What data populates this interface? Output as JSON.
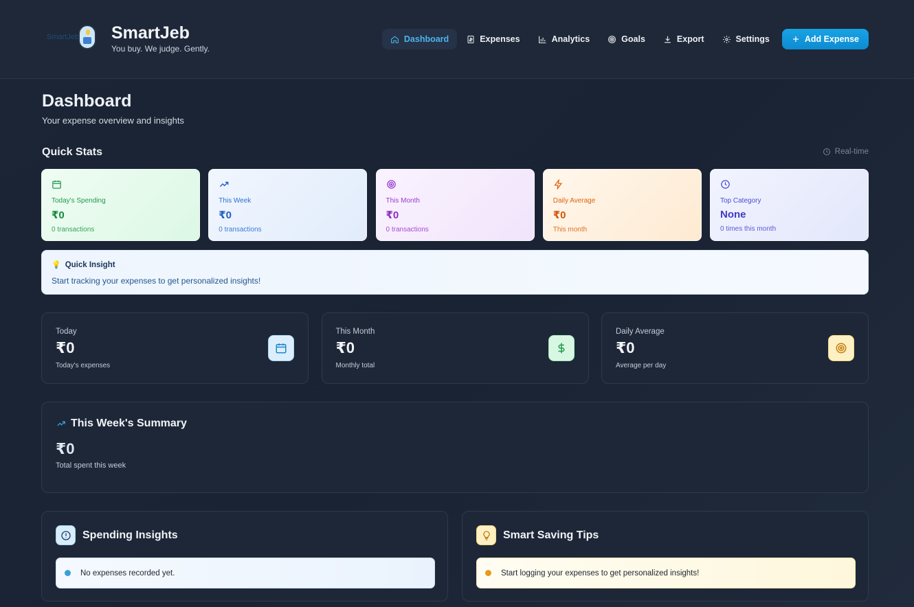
{
  "app": {
    "title": "SmartJeb",
    "tagline": "You buy. We judge. Gently.",
    "logo_alt": "SmartJeb"
  },
  "nav": {
    "items": [
      {
        "label": "Dashboard",
        "icon": "home-icon",
        "active": true
      },
      {
        "label": "Expenses",
        "icon": "receipt-icon"
      },
      {
        "label": "Analytics",
        "icon": "bar-chart-icon"
      },
      {
        "label": "Goals",
        "icon": "target-icon"
      },
      {
        "label": "Export",
        "icon": "download-icon"
      },
      {
        "label": "Settings",
        "icon": "gear-icon"
      }
    ],
    "add_button": "Add Expense"
  },
  "page": {
    "title": "Dashboard",
    "subtitle": "Your expense overview and insights"
  },
  "quick_stats": {
    "title": "Quick Stats",
    "realtime": "Real-time",
    "cards": [
      {
        "label": "Today's Spending",
        "value": "₹0",
        "sub": "0 transactions",
        "icon": "calendar-icon",
        "color": "#1f9a4a"
      },
      {
        "label": "This Week",
        "value": "₹0",
        "sub": "0 transactions",
        "icon": "trending-up-icon",
        "color": "#2b6fd1"
      },
      {
        "label": "This Month",
        "value": "₹0",
        "sub": "0 transactions",
        "icon": "target-icon",
        "color": "#9b3ad1"
      },
      {
        "label": "Daily Average",
        "value": "₹0",
        "sub": "This month",
        "icon": "lightning-icon",
        "color": "#e0620f"
      },
      {
        "label": "Top Category",
        "value": "None",
        "sub": "0 times this month",
        "icon": "clock-icon",
        "color": "#4d4bd1"
      }
    ]
  },
  "quick_insight": {
    "title": "Quick Insight",
    "text": "Start tracking your expenses to get personalized insights!"
  },
  "summary_cards": [
    {
      "label": "Today",
      "value": "₹0",
      "sub": "Today's expenses",
      "icon": "calendar-icon"
    },
    {
      "label": "This Month",
      "value": "₹0",
      "sub": "Monthly total",
      "icon": "dollar-icon"
    },
    {
      "label": "Daily Average",
      "value": "₹0",
      "sub": "Average per day",
      "icon": "target-icon"
    }
  ],
  "week_summary": {
    "title": "This Week's Summary",
    "value": "₹0",
    "sub": "Total spent this week"
  },
  "spending_insights": {
    "title": "Spending Insights",
    "item": "No expenses recorded yet."
  },
  "saving_tips": {
    "title": "Smart Saving Tips",
    "item": "Start logging your expenses to get personalized insights!"
  }
}
